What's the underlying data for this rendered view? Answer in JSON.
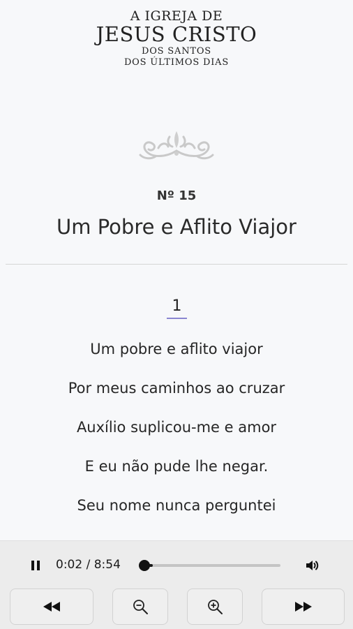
{
  "header": {
    "logo_line1": "A IGREJA DE",
    "logo_line2": "JESUS CRISTO",
    "logo_line3": "DOS SANTOS",
    "logo_line4": "DOS ÚLTIMOS DIAS"
  },
  "hymn": {
    "number": "Nº 15",
    "title": "Um Pobre e Aflito Viajor",
    "ornament_icon": "flourish-ornament-icon"
  },
  "verse": {
    "number": "1",
    "lines": [
      "Um pobre e aflito viajor",
      "Por meus caminhos ao cruzar",
      "Auxílio suplicou-me e amor",
      "E eu não pude lhe negar.",
      "Seu nome nunca perguntei"
    ]
  },
  "player": {
    "state": "playing",
    "time_display": "0:02 / 8:54",
    "progress_fraction": 0.004,
    "buttons": [
      {
        "name": "rewind-button",
        "icon": "rewind-icon"
      },
      {
        "name": "zoom-out-button",
        "icon": "zoom-out-icon"
      },
      {
        "name": "zoom-in-button",
        "icon": "zoom-in-icon"
      },
      {
        "name": "fast-forward-button",
        "icon": "fast-forward-icon"
      }
    ]
  },
  "colors": {
    "background": "#f7f8fa",
    "accent_underline": "#8a86d1",
    "player_bar": "#ececec"
  }
}
